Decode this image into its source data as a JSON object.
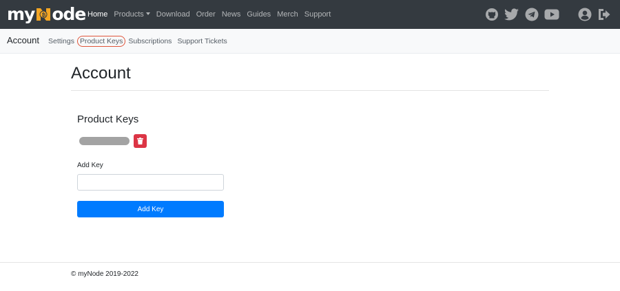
{
  "brand": {
    "name_left": "my",
    "name_right": "ode",
    "logo_badge": "₿"
  },
  "navbar": {
    "links": [
      {
        "label": "Home",
        "active": true
      },
      {
        "label": "Products",
        "has_dropdown": true
      },
      {
        "label": "Download"
      },
      {
        "label": "Order"
      },
      {
        "label": "News"
      },
      {
        "label": "Guides"
      },
      {
        "label": "Merch"
      },
      {
        "label": "Support"
      }
    ],
    "icons": [
      "github-icon",
      "twitter-icon",
      "telegram-icon",
      "youtube-icon",
      "user-icon",
      "logout-icon"
    ]
  },
  "subnav": {
    "title": "Account",
    "links": [
      {
        "label": "Settings"
      },
      {
        "label": "Product Keys",
        "highlighted": true
      },
      {
        "label": "Subscriptions"
      },
      {
        "label": "Support Tickets"
      }
    ]
  },
  "main": {
    "page_title": "Account",
    "section_title": "Product Keys",
    "add_key_label": "Add Key",
    "add_key_input_value": "",
    "add_key_button": "Add Key"
  },
  "footer": {
    "copyright": "© myNode 2019-2022"
  },
  "colors": {
    "navbar_bg": "#343a40",
    "brand_accent": "#f5a623",
    "primary": "#007bff",
    "danger": "#dc3545",
    "highlight_ring": "#e0553a"
  }
}
